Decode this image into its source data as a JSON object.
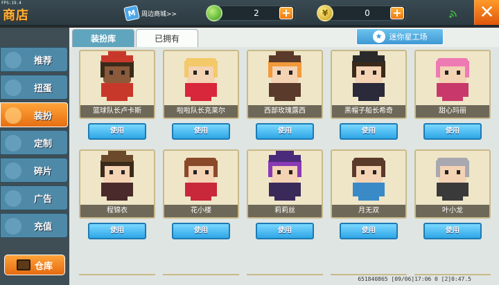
{
  "fps": "FPS:19.4",
  "header": {
    "title": "商店",
    "mall_link": "周边商城>>",
    "green_currency": "2",
    "gold_currency": "0",
    "plus": "+",
    "close": "✕"
  },
  "sidebar": {
    "items": [
      {
        "label": "推荐",
        "active": false
      },
      {
        "label": "扭蛋",
        "active": false
      },
      {
        "label": "装扮",
        "active": true
      },
      {
        "label": "定制",
        "active": false
      },
      {
        "label": "碎片",
        "active": false
      },
      {
        "label": "广告",
        "active": false
      },
      {
        "label": "充值",
        "active": false
      }
    ],
    "warehouse_label": "仓库"
  },
  "main": {
    "tabs": [
      {
        "label": "装扮库",
        "active": true
      },
      {
        "label": "已拥有",
        "active": false
      }
    ],
    "workshop_label": "迷你星工场",
    "use_label": "使用",
    "cards": [
      {
        "name": "篮球队长卢卡斯",
        "skin": "#8a5a3a",
        "hair": "#3a2a1a",
        "outfit": "#c8382a",
        "hat": "#c8382a"
      },
      {
        "name": "啦啦队长克莱尔",
        "skin": "#f4d2b4",
        "hair": "#f3c96a",
        "outfit": "#d8263a",
        "hat": ""
      },
      {
        "name": "西部玫瑰露西",
        "skin": "#f4d2b4",
        "hair": "#f39a3a",
        "outfit": "#5a3a2a",
        "hat": "#5a3a2a"
      },
      {
        "name": "黑帽子船长希奇",
        "skin": "#f4d2b4",
        "hair": "#3a2a1a",
        "outfit": "#2a2a3a",
        "hat": "#2a2a2a"
      },
      {
        "name": "甜心玛丽",
        "skin": "#f4d2b4",
        "hair": "#ee7ab4",
        "outfit": "#c8386a",
        "hat": ""
      },
      {
        "name": "程锦衣",
        "skin": "#f4d2b4",
        "hair": "#3a2a1a",
        "outfit": "#4a2a2a",
        "hat": "#6a4a2a"
      },
      {
        "name": "花小楼",
        "skin": "#f4d2b4",
        "hair": "#8a4a2a",
        "outfit": "#c8283a",
        "hat": ""
      },
      {
        "name": "莉莉丝",
        "skin": "#f4d2b4",
        "hair": "#8a3ab4",
        "outfit": "#3a2a5a",
        "hat": "#4a2a7a"
      },
      {
        "name": "月无双",
        "skin": "#f4d2b4",
        "hair": "#5a3a2a",
        "outfit": "#3a8ac8",
        "hat": ""
      },
      {
        "name": "叶小龙",
        "skin": "#f4d2b4",
        "hair": "#a8a8b0",
        "outfit": "#3a3a3a",
        "hat": ""
      }
    ]
  },
  "footer": {
    "text": "651840865  [09/06]17:06 0  [2]0:47.5"
  }
}
